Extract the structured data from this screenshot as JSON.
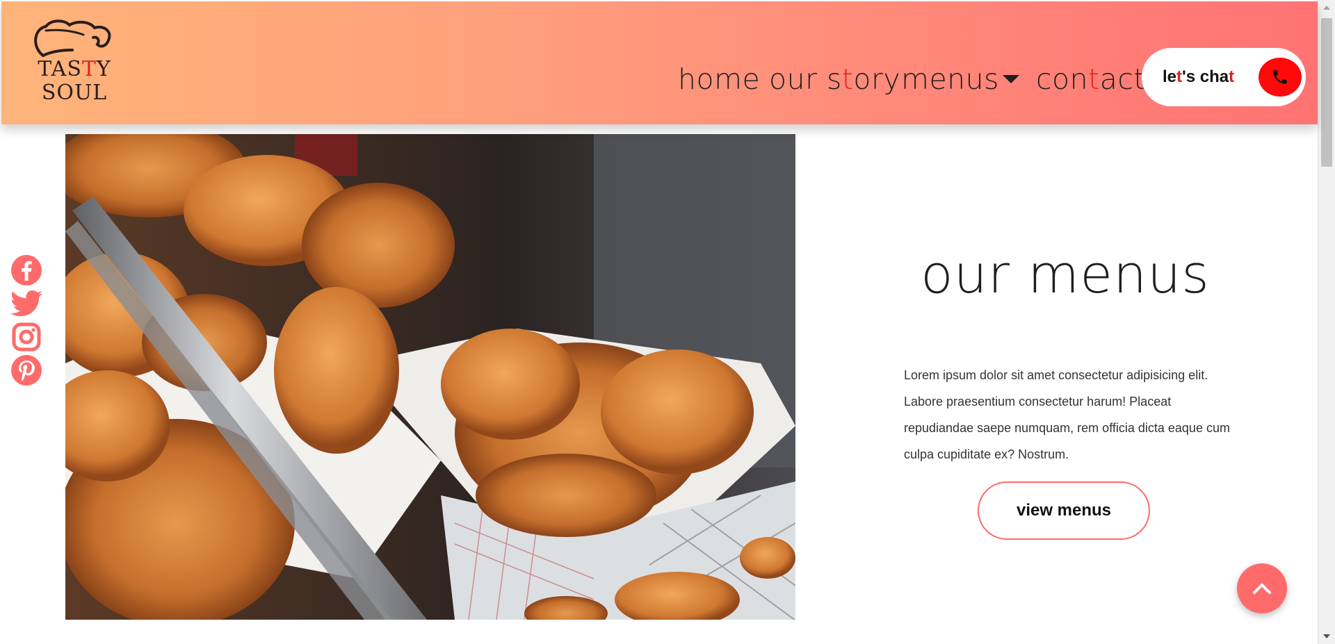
{
  "brand": {
    "logo_line1_a": "TAS",
    "logo_line1_b": "T",
    "logo_line1_c": "Y",
    "logo_line2": "SOUL",
    "accent_color": "#e0201f",
    "header_gradient": [
      "#ffb47a",
      "#ff7373"
    ]
  },
  "nav": {
    "home": "home",
    "story_a": "our s",
    "story_b": "t",
    "story_c": "ory",
    "menus": "menus",
    "contact_a": "con",
    "contact_b": "t",
    "contact_c": "act"
  },
  "chat": {
    "label_a": "le",
    "label_b": "t",
    "label_c": "'s cha",
    "label_d": "t",
    "icon": "phone-icon"
  },
  "social": [
    "facebook-icon",
    "twitter-icon",
    "instagram-icon",
    "pinterest-icon"
  ],
  "main": {
    "title": "our menus",
    "paragraph": "Lorem ipsum dolor sit amet consectetur adipisicing elit. Labore praesentium consectetur harum! Placeat repudiandae saepe numquam, rem officia dicta eaque cum culpa cupiditate ex? Nostrum.",
    "button": "view menus"
  },
  "scroll_top": {
    "icon": "chevron-up-icon"
  },
  "colors": {
    "button_border": "#ff6b6b",
    "phone_bg": "#ff0a0a",
    "social": "#ff6b6b"
  }
}
